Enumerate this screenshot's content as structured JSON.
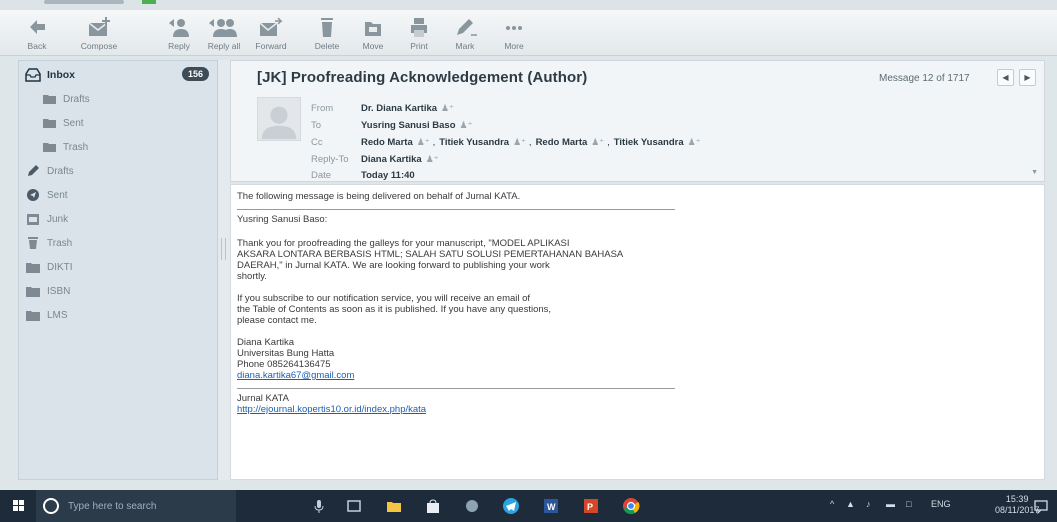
{
  "toolbar": {
    "back": "Back",
    "compose": "Compose",
    "reply": "Reply",
    "reply_all": "Reply all",
    "forward": "Forward",
    "delete": "Delete",
    "move": "Move",
    "print": "Print",
    "mark": "Mark",
    "more": "More"
  },
  "sidebar": {
    "inbox": "Inbox",
    "inbox_count": "156",
    "items": [
      {
        "label": "Drafts",
        "icon": "folder-icon"
      },
      {
        "label": "Sent",
        "icon": "folder-icon"
      },
      {
        "label": "Trash",
        "icon": "folder-icon"
      },
      {
        "label": "Drafts",
        "icon": "pencil-icon"
      },
      {
        "label": "Sent",
        "icon": "send-icon"
      },
      {
        "label": "Junk",
        "icon": "junk-icon"
      },
      {
        "label": "Trash",
        "icon": "trash-icon"
      },
      {
        "label": "DIKTI",
        "icon": "folder-icon"
      },
      {
        "label": "ISBN",
        "icon": "folder-icon"
      },
      {
        "label": "LMS",
        "icon": "folder-icon"
      }
    ]
  },
  "message": {
    "subject": "[JK] Proofreading Acknowledgement (Author)",
    "counter": "Message 12 of 1717",
    "headers": {
      "from_label": "From",
      "from": "Dr. Diana Kartika",
      "to_label": "To",
      "to": "Yusring Sanusi Baso",
      "cc_label": "Cc",
      "cc": [
        "Redo Marta",
        "Titiek Yusandra",
        "Redo Marta",
        "Titiek Yusandra"
      ],
      "replyto_label": "Reply-To",
      "replyto": "Diana Kartika",
      "date_label": "Date",
      "date": "Today 11:40"
    },
    "body": {
      "intro": "The following message is being delivered on behalf of Jurnal KATA.",
      "greeting": "Yusring Sanusi Baso:",
      "para1_l1": "Thank you for proofreading the galleys for your manuscript, \"MODEL APLIKASI",
      "para1_l2": "AKSARA LONTARA BERBASIS HTML;  SALAH SATU SOLUSI PEMERTAHANAN BAHASA",
      "para1_l3": "DAERAH,\" in Jurnal KATA. We are looking forward to publishing your work",
      "para1_l4": "shortly.",
      "para2_l1": "If you subscribe to our notification service, you will receive an email of",
      "para2_l2": "the Table of Contents as soon as it is published. If you have any questions,",
      "para2_l3": "please contact me.",
      "sig_name": "Diana Kartika",
      "sig_org": "Universitas Bung Hatta",
      "sig_phone": "Phone 085264136475",
      "sig_email": "diana.kartika67@gmail.com",
      "footer_name": "Jurnal KATA",
      "footer_url": "http://ejournal.kopertis10.or.id/index.php/kata"
    }
  },
  "taskbar": {
    "search_placeholder": "Type here to search",
    "tray_lang": "ENG",
    "time": "15:39",
    "date": "08/11/2017"
  }
}
